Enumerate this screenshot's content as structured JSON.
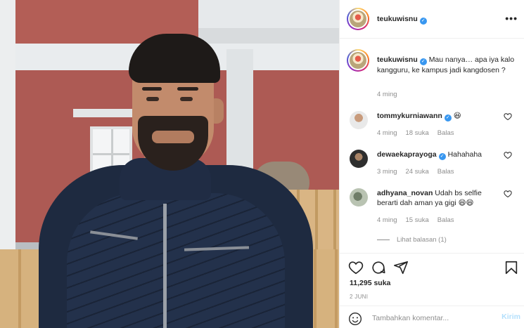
{
  "post": {
    "username": "teukuwisnu",
    "verified_mark": "✓",
    "more_icon": "•••",
    "caption": {
      "username": "teukuwisnu",
      "text": "Mau nanya… apa iya kalo kangguru, ke kampus jadi kangdosen ?",
      "time": "4 ming"
    }
  },
  "comments": [
    {
      "username": "tommykurniawann",
      "verified": true,
      "text": "😆",
      "time": "4 ming",
      "likes": "18 suka",
      "reply": "Balas",
      "avatar_color": "#c7c9c9"
    },
    {
      "username": "dewaekaprayoga",
      "verified": true,
      "text": "Hahahaha",
      "time": "3 ming",
      "likes": "24 suka",
      "reply": "Balas",
      "avatar_color": "#3b3b3b"
    },
    {
      "username": "adhyana_novan",
      "verified": false,
      "text": "Udah bs selfie berarti dah aman ya gigi 😄😄",
      "time": "4 ming",
      "likes": "15 suka",
      "reply": "Balas",
      "avatar_color": "#a3b09b"
    }
  ],
  "view_replies": "Lihat balasan (1)",
  "actions": {
    "like_icon": "heart-icon",
    "comment_icon": "comment-icon",
    "share_icon": "share-icon",
    "save_icon": "bookmark-icon"
  },
  "likes_count": "11,295 suka",
  "date": "2 JUNI",
  "comment_box": {
    "placeholder": "Tambahkan komentar...",
    "post_label": "Kirim"
  },
  "colors": {
    "verified": "#3897f0",
    "muted": "#8e8e8e",
    "post_button": "#b2dffc"
  }
}
